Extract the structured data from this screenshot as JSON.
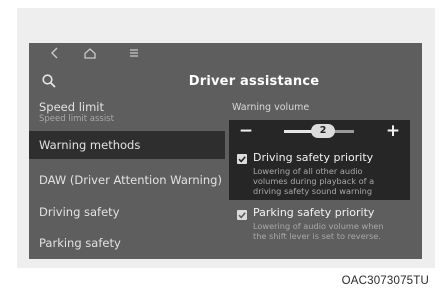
{
  "nav": {
    "back_icon": "chevron-left-icon",
    "home_icon": "home-icon",
    "menu_icon": "menu-icon"
  },
  "header": {
    "title": "Driver assistance",
    "search_icon": "search-icon"
  },
  "menu": {
    "items": [
      {
        "label": "Speed limit",
        "sub": "Speed limit assist"
      },
      {
        "label": "Warning methods"
      },
      {
        "label": "DAW (Driver Attention Warning)"
      },
      {
        "label": "Driving safety"
      },
      {
        "label": "Parking safety"
      }
    ],
    "selected_index": 1
  },
  "warning_volume": {
    "label": "Warning volume",
    "minus": "−",
    "plus": "+",
    "value": "2",
    "level_fraction": 0.5
  },
  "options": [
    {
      "title": "Driving safety priority",
      "desc_lines": [
        "Lowering of all other audio",
        "volumes during playback of a",
        "driving safety sound warning"
      ],
      "checked": true
    },
    {
      "title": "Parking safety priority",
      "desc_lines": [
        "Lowering of audio volume when",
        "the shift lever is set to reverse."
      ],
      "checked": true
    }
  ],
  "caption": "OAC3073075TU",
  "colors": {
    "screen_bg": "#5e5e5e",
    "panel_dark": "#262626",
    "text_light": "#e8e8e8"
  }
}
